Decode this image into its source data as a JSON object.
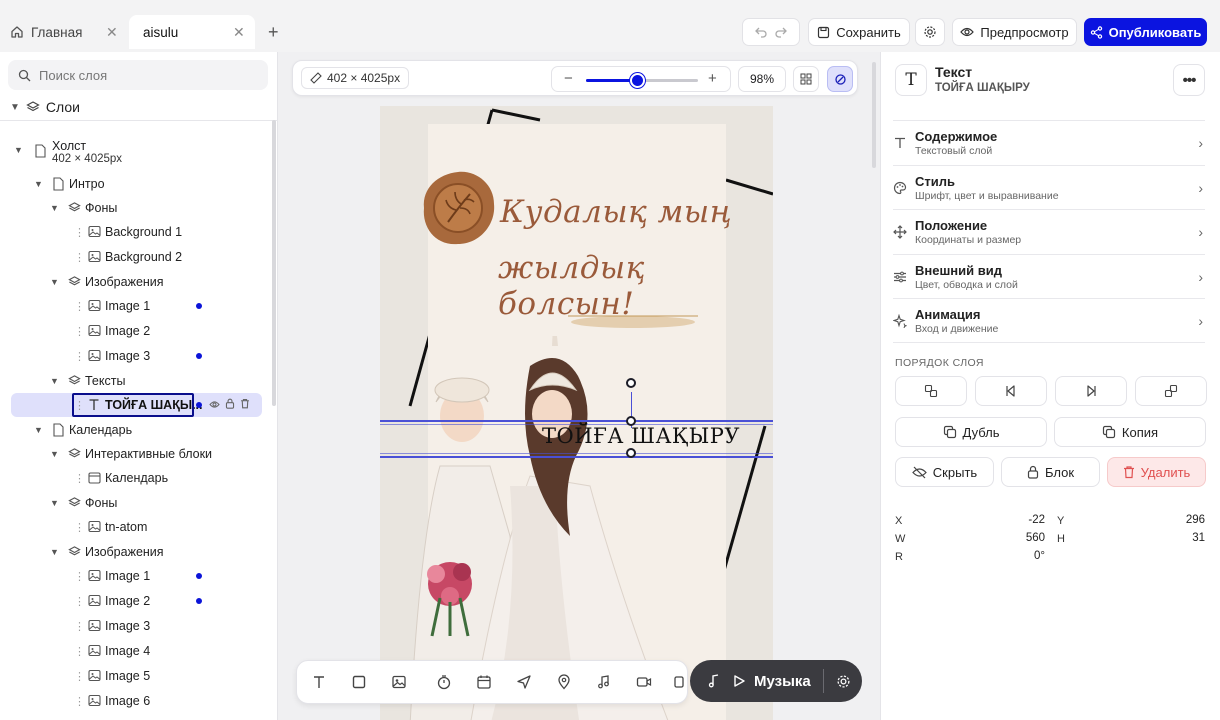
{
  "tabs": [
    {
      "label": "Главная"
    },
    {
      "label": "aisulu"
    }
  ],
  "toolbar": {
    "save_label": "Сохранить",
    "preview_label": "Предпросмотр",
    "publish_label": "Опубликовать"
  },
  "left": {
    "search_placeholder": "Поиск слоя",
    "layers_title": "Слои",
    "canvas": {
      "label": "Холст",
      "size": "402 × 4025px"
    },
    "tree": [
      {
        "label": "Интро"
      },
      {
        "label": "Фоны"
      },
      {
        "label": "Background 1"
      },
      {
        "label": "Background 2"
      },
      {
        "label": "Изображения"
      },
      {
        "label": "Image 1"
      },
      {
        "label": "Image 2"
      },
      {
        "label": "Image 3"
      },
      {
        "label": "Тексты"
      },
      {
        "label": "ТОЙҒА ШАҚЫ..."
      },
      {
        "label": "Календарь"
      },
      {
        "label": "Интерактивные блоки"
      },
      {
        "label": "Календарь"
      },
      {
        "label": "Фоны"
      },
      {
        "label": "tn-atom"
      },
      {
        "label": "Изображения"
      },
      {
        "label": "Image 1"
      },
      {
        "label": "Image 2"
      },
      {
        "label": "Image 3"
      },
      {
        "label": "Image 4"
      },
      {
        "label": "Image 5"
      },
      {
        "label": "Image 6"
      }
    ]
  },
  "canvas": {
    "dimensions": "402 × 4025px",
    "zoom_label": "98%",
    "zoom_level": 0.98,
    "script_line1": "Кудалық мың",
    "script_line2": "жылдық болсын!",
    "title_text": "ТОЙҒА ШАҚЫРУ"
  },
  "music": {
    "label": "Музыка"
  },
  "right": {
    "title": "Текст",
    "subtitle": "ТОЙҒА ШАҚЫРУ",
    "sections": [
      {
        "title": "Содержимое",
        "sub": "Текстовый слой"
      },
      {
        "title": "Стиль",
        "sub": "Шрифт, цвет и выравнивание"
      },
      {
        "title": "Положение",
        "sub": "Координаты и размер"
      },
      {
        "title": "Внешний вид",
        "sub": "Цвет, обводка и слой"
      },
      {
        "title": "Анимация",
        "sub": "Вход и движение"
      }
    ],
    "order_label": "ПОРЯДОК СЛОЯ",
    "duplicate_label": "Дубль",
    "copy_label": "Копия",
    "hide_label": "Скрыть",
    "lock_label": "Блок",
    "delete_label": "Удалить",
    "coords": {
      "x_label": "X",
      "x": "-22",
      "y_label": "Y",
      "y": "296",
      "w_label": "W",
      "w": "560",
      "h_label": "H",
      "h": "31",
      "r_label": "R",
      "r": "0°"
    }
  },
  "colors": {
    "accent": "#0b14e0",
    "script": "#9a5a3a",
    "danger": "#e05050"
  }
}
